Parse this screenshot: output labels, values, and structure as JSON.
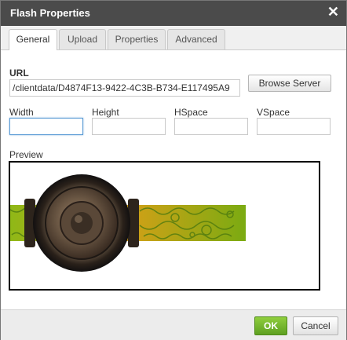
{
  "dialog": {
    "title": "Flash Properties"
  },
  "tabs": [
    {
      "label": "General",
      "active": true
    },
    {
      "label": "Upload",
      "active": false
    },
    {
      "label": "Properties",
      "active": false
    },
    {
      "label": "Advanced",
      "active": false
    }
  ],
  "form": {
    "url_label": "URL",
    "url_value": "/clientdata/D4874F13-9422-4C3B-B734-E117495A9",
    "browse_label": "Browse Server",
    "width_label": "Width",
    "width_value": "",
    "height_label": "Height",
    "height_value": "",
    "hspace_label": "HSpace",
    "hspace_value": "",
    "vspace_label": "VSpace",
    "vspace_value": "",
    "preview_label": "Preview"
  },
  "footer": {
    "ok_label": "OK",
    "cancel_label": "Cancel"
  },
  "colors": {
    "titlebar": "#4b4b4b",
    "ok_green": "#6cb52b",
    "focus_blue": "#5a9bd5"
  }
}
